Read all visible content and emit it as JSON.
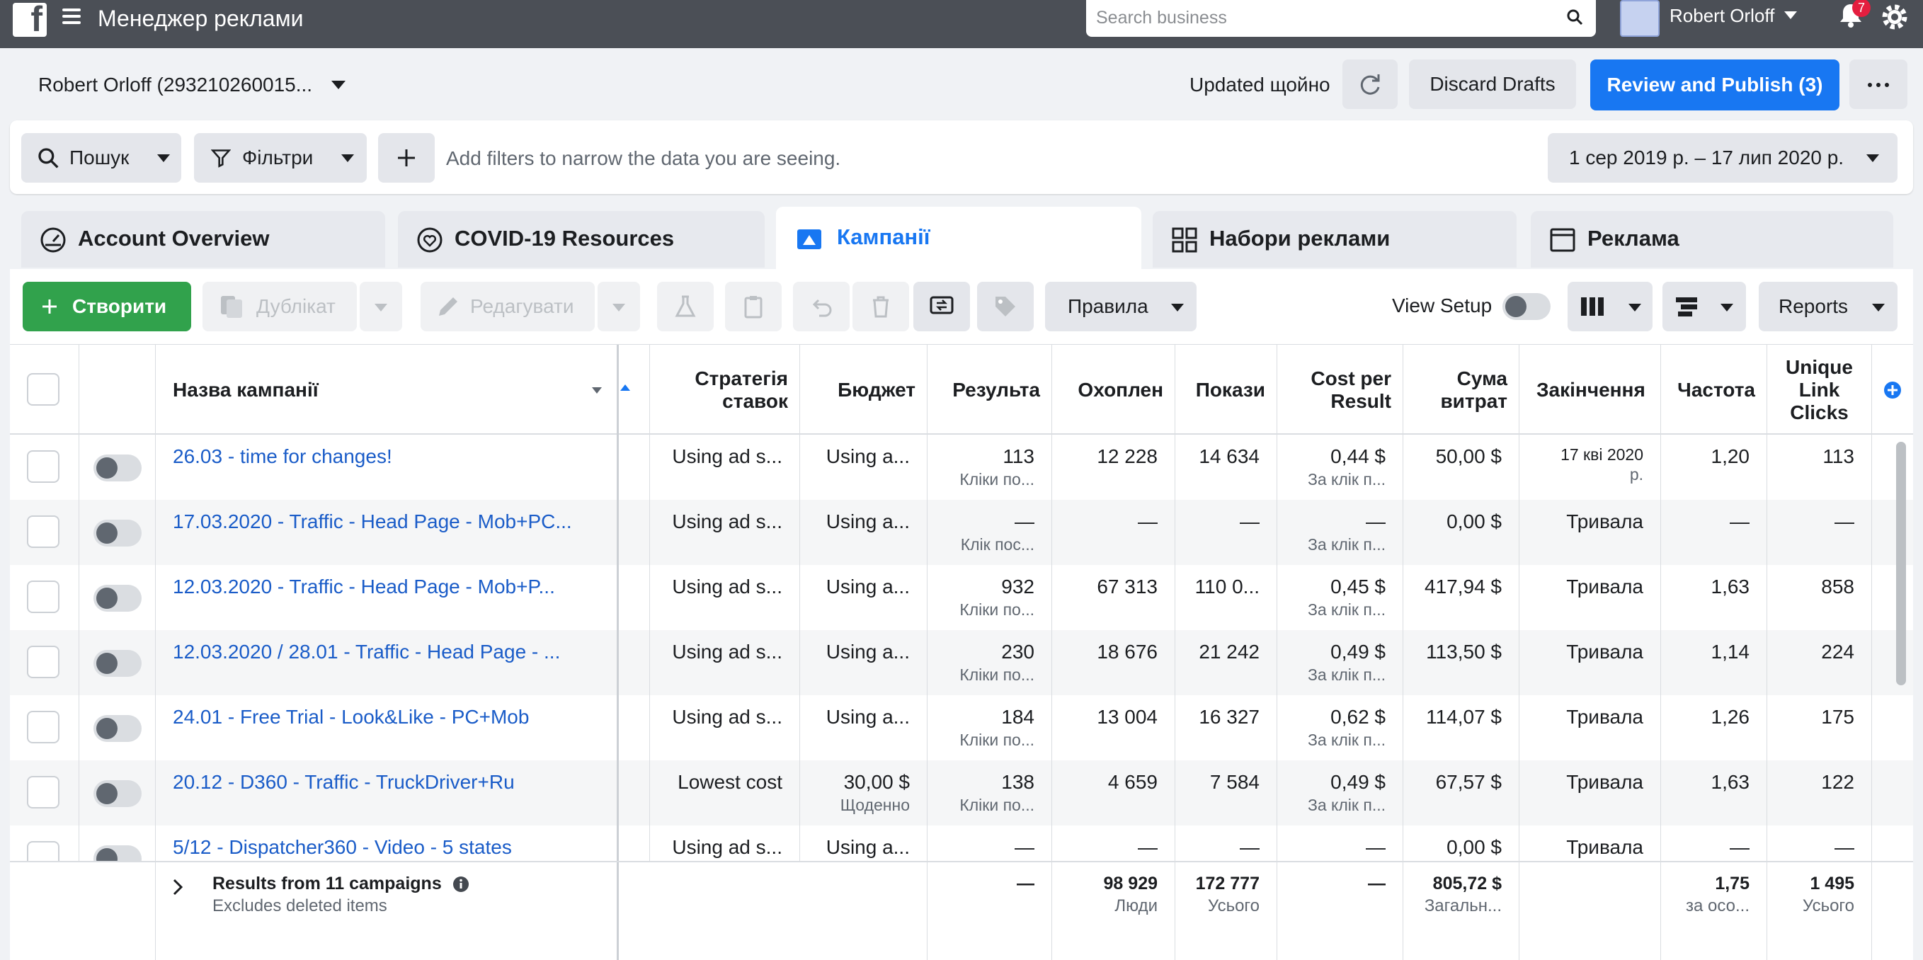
{
  "topbar": {
    "app_title": "Менеджер реклами",
    "search_placeholder": "Search business",
    "user_name": "Robert Orloff",
    "notifications_count": "7"
  },
  "account": {
    "name": "Robert Orloff (293210260015...",
    "updated": "Updated щойно",
    "discard_label": "Discard Drafts",
    "publish_label": "Review and Publish (3)"
  },
  "filters": {
    "search_label": "Пошук",
    "filters_label": "Фільтри",
    "hint": "Add filters to narrow the data you are seeing.",
    "date_range": "1 сер 2019 р. – 17 лип 2020 р."
  },
  "tabs": [
    {
      "label": "Account Overview"
    },
    {
      "label": "COVID-19 Resources"
    },
    {
      "label": "Кампанії"
    },
    {
      "label": "Набори реклами"
    },
    {
      "label": "Реклама"
    }
  ],
  "toolbar": {
    "create_label": "Створити",
    "duplicate_label": "Дублікат",
    "edit_label": "Редагувати",
    "rules_label": "Правила",
    "view_setup_label": "View Setup",
    "reports_label": "Reports"
  },
  "table": {
    "headers": {
      "name": "Назва кампанії",
      "bid": "Стратегія ставок",
      "budget": "Бюджет",
      "results": "Результа",
      "reach": "Охоплен",
      "impressions": "Покази",
      "cpr": "Cost per Result",
      "spent": "Сума витрат",
      "ends": "Закінчення",
      "frequency": "Частота",
      "ulc": "Unique Link Clicks"
    },
    "rows": [
      {
        "name": "26.03 - time for changes!",
        "bid": "Using ad s...",
        "budget": "Using a...",
        "budget_sub": "",
        "results": "113",
        "results_sub": "Кліки по...",
        "reach": "12 228",
        "impressions": "14 634",
        "cpr": "0,44 $",
        "cpr_sub": "За клік п...",
        "spent": "50,00 $",
        "ends": "17 кві 2020",
        "ends_sub": "р.",
        "frequency": "1,20",
        "ulc": "113"
      },
      {
        "name": "17.03.2020 - Traffic - Head Page - Mob+PC...",
        "bid": "Using ad s...",
        "budget": "Using a...",
        "budget_sub": "",
        "results": "—",
        "results_sub": "Клік пос...",
        "reach": "—",
        "impressions": "—",
        "cpr": "—",
        "cpr_sub": "За клік п...",
        "spent": "0,00 $",
        "ends": "Тривала",
        "ends_sub": "",
        "frequency": "—",
        "ulc": "—"
      },
      {
        "name": "12.03.2020 - Traffic - Head Page - Mob+P...",
        "bid": "Using ad s...",
        "budget": "Using a...",
        "budget_sub": "",
        "results": "932",
        "results_sub": "Кліки по...",
        "reach": "67 313",
        "impressions": "110 0...",
        "cpr": "0,45 $",
        "cpr_sub": "За клік п...",
        "spent": "417,94 $",
        "ends": "Тривала",
        "ends_sub": "",
        "frequency": "1,63",
        "ulc": "858"
      },
      {
        "name": "12.03.2020 / 28.01 - Traffic - Head Page - ...",
        "bid": "Using ad s...",
        "budget": "Using a...",
        "budget_sub": "",
        "results": "230",
        "results_sub": "Кліки по...",
        "reach": "18 676",
        "impressions": "21 242",
        "cpr": "0,49 $",
        "cpr_sub": "За клік п...",
        "spent": "113,50 $",
        "ends": "Тривала",
        "ends_sub": "",
        "frequency": "1,14",
        "ulc": "224"
      },
      {
        "name": "24.01 - Free Trial - Look&Like - PC+Mob",
        "bid": "Using ad s...",
        "budget": "Using a...",
        "budget_sub": "",
        "results": "184",
        "results_sub": "Кліки по...",
        "reach": "13 004",
        "impressions": "16 327",
        "cpr": "0,62 $",
        "cpr_sub": "За клік п...",
        "spent": "114,07 $",
        "ends": "Тривала",
        "ends_sub": "",
        "frequency": "1,26",
        "ulc": "175"
      },
      {
        "name": "20.12 - D360 - Traffic - TruckDriver+Ru",
        "bid": "Lowest cost",
        "budget": "30,00 $",
        "budget_sub": "Щоденно",
        "results": "138",
        "results_sub": "Кліки по...",
        "reach": "4 659",
        "impressions": "7 584",
        "cpr": "0,49 $",
        "cpr_sub": "За клік п...",
        "spent": "67,57 $",
        "ends": "Тривала",
        "ends_sub": "",
        "frequency": "1,63",
        "ulc": "122"
      },
      {
        "name": "5/12 - Dispatcher360 - Video - 5 states",
        "bid": "Using ad s...",
        "budget": "Using a...",
        "budget_sub": "",
        "results": "—",
        "results_sub": "",
        "reach": "—",
        "impressions": "—",
        "cpr": "—",
        "cpr_sub": "",
        "spent": "0,00 $",
        "ends": "Тривала",
        "ends_sub": "",
        "frequency": "—",
        "ulc": "—"
      }
    ],
    "footer": {
      "title": "Results from 11 campaigns",
      "subtitle": "Excludes deleted items",
      "results": "—",
      "reach": "98 929",
      "reach_sub": "Люди",
      "impressions": "172 777",
      "impressions_sub": "Усього",
      "cpr": "—",
      "spent": "805,72 $",
      "spent_sub": "Загальн...",
      "frequency": "1,75",
      "frequency_sub": "за осо...",
      "ulc": "1 495",
      "ulc_sub": "Усього"
    }
  },
  "colors": {
    "topbar": "#4b4f56",
    "accent_blue": "#1877f2",
    "create_green": "#31a24c",
    "link_blue": "#1a5cc8"
  }
}
